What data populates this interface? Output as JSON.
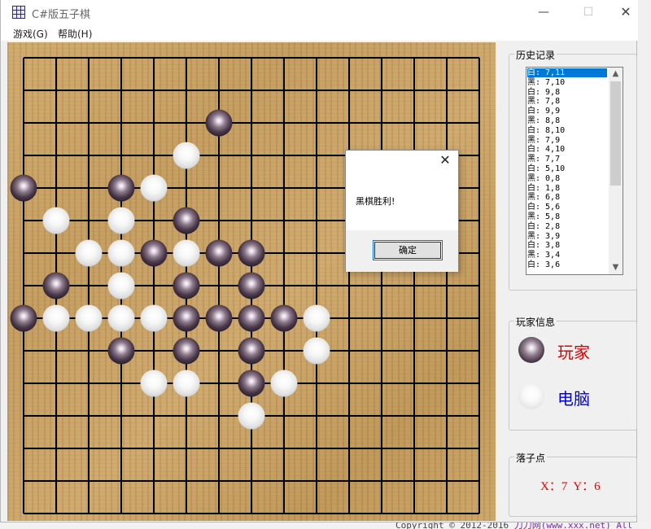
{
  "window": {
    "title": "C#版五子棋",
    "minimize": "—",
    "maximize": "☐",
    "close": "✕"
  },
  "menu": [
    {
      "label": "游戏(G)"
    },
    {
      "label": "帮助(H)"
    }
  ],
  "board": {
    "size": 15,
    "stones": [
      {
        "x": 6,
        "y": 2,
        "color": "black"
      },
      {
        "x": 5,
        "y": 3,
        "color": "white"
      },
      {
        "x": 0,
        "y": 4,
        "color": "black"
      },
      {
        "x": 3,
        "y": 4,
        "color": "black"
      },
      {
        "x": 4,
        "y": 4,
        "color": "white"
      },
      {
        "x": 1,
        "y": 5,
        "color": "white"
      },
      {
        "x": 3,
        "y": 5,
        "color": "white"
      },
      {
        "x": 5,
        "y": 5,
        "color": "black"
      },
      {
        "x": 2,
        "y": 6,
        "color": "white"
      },
      {
        "x": 3,
        "y": 6,
        "color": "white"
      },
      {
        "x": 4,
        "y": 6,
        "color": "black"
      },
      {
        "x": 5,
        "y": 6,
        "color": "white"
      },
      {
        "x": 6,
        "y": 6,
        "color": "black"
      },
      {
        "x": 7,
        "y": 6,
        "color": "black"
      },
      {
        "x": 1,
        "y": 7,
        "color": "black"
      },
      {
        "x": 3,
        "y": 7,
        "color": "white"
      },
      {
        "x": 5,
        "y": 7,
        "color": "black"
      },
      {
        "x": 7,
        "y": 7,
        "color": "black"
      },
      {
        "x": 0,
        "y": 8,
        "color": "black"
      },
      {
        "x": 1,
        "y": 8,
        "color": "white"
      },
      {
        "x": 2,
        "y": 8,
        "color": "white"
      },
      {
        "x": 3,
        "y": 8,
        "color": "white"
      },
      {
        "x": 4,
        "y": 8,
        "color": "white"
      },
      {
        "x": 5,
        "y": 8,
        "color": "black"
      },
      {
        "x": 6,
        "y": 8,
        "color": "black"
      },
      {
        "x": 7,
        "y": 8,
        "color": "black"
      },
      {
        "x": 8,
        "y": 8,
        "color": "black"
      },
      {
        "x": 9,
        "y": 8,
        "color": "white"
      },
      {
        "x": 3,
        "y": 9,
        "color": "black"
      },
      {
        "x": 5,
        "y": 9,
        "color": "black"
      },
      {
        "x": 7,
        "y": 9,
        "color": "black"
      },
      {
        "x": 9,
        "y": 9,
        "color": "white"
      },
      {
        "x": 4,
        "y": 10,
        "color": "white"
      },
      {
        "x": 5,
        "y": 10,
        "color": "white"
      },
      {
        "x": 7,
        "y": 10,
        "color": "black"
      },
      {
        "x": 8,
        "y": 10,
        "color": "white"
      },
      {
        "x": 7,
        "y": 11,
        "color": "white"
      }
    ]
  },
  "history": {
    "title": "历史记录",
    "items": [
      "白: 7,11",
      "黑: 7,10",
      "白: 9,8",
      "黑: 7,8",
      "白: 9,9",
      "黑: 8,8",
      "白: 8,10",
      "黑: 7,9",
      "白: 4,10",
      "黑: 7,7",
      "白: 5,10",
      "黑: 0,8",
      "白: 1,8",
      "黑: 6,8",
      "白: 5,6",
      "黑: 5,8",
      "白: 2,8",
      "黑: 3,9",
      "白: 3,8",
      "黑: 3,4",
      "白: 3,6"
    ],
    "selected_index": 0,
    "scroll_up": "▲",
    "scroll_down": "▼"
  },
  "players": {
    "title": "玩家信息",
    "human": {
      "label": "玩家",
      "color": "#e00000"
    },
    "computer": {
      "label": "电脑",
      "color": "#0000e0"
    }
  },
  "coords": {
    "title": "落子点",
    "text": "X：7  Y：6"
  },
  "dialog": {
    "message": "黑棋胜利!",
    "ok_label": "确定",
    "close": "✕"
  },
  "background": {
    "footer_text": "Copyright © 2012-2016",
    "footer_link": "刀刀网(www.xxx.net) All"
  },
  "colors": {
    "accent": "#0078d7",
    "board_line": "#000000",
    "human": "#e00000",
    "computer": "#0000e0"
  }
}
